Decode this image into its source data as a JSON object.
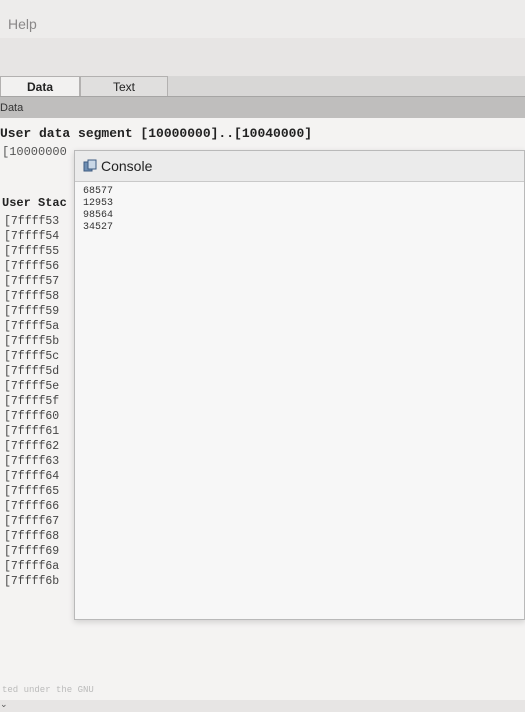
{
  "menu": {
    "help": "Help"
  },
  "tabs": [
    {
      "label": "Data"
    },
    {
      "label": "Text"
    }
  ],
  "panel": {
    "header": "Data"
  },
  "data_view": {
    "segment_title": "User data segment [10000000]..[10040000]",
    "segment_first_addr": "[10000000",
    "stack_title": "User Stac",
    "stack_addresses": [
      "[7ffff53",
      "[7ffff54",
      "[7ffff55",
      "[7ffff56",
      "[7ffff57",
      "[7ffff58",
      "[7ffff59",
      "[7ffff5a",
      "[7ffff5b",
      "[7ffff5c",
      "[7ffff5d",
      "[7ffff5e",
      "[7ffff5f",
      "[7ffff60",
      "[7ffff61",
      "[7ffff62",
      "[7ffff63",
      "[7ffff64",
      "[7ffff65",
      "[7ffff66",
      "[7ffff67",
      "[7ffff68",
      "[7ffff69",
      "[7ffff6a",
      "[7ffff6b"
    ],
    "footer": "ted under the GNU"
  },
  "console": {
    "title": "Console",
    "lines": [
      "68577",
      "12953",
      "98564",
      "34527"
    ]
  }
}
